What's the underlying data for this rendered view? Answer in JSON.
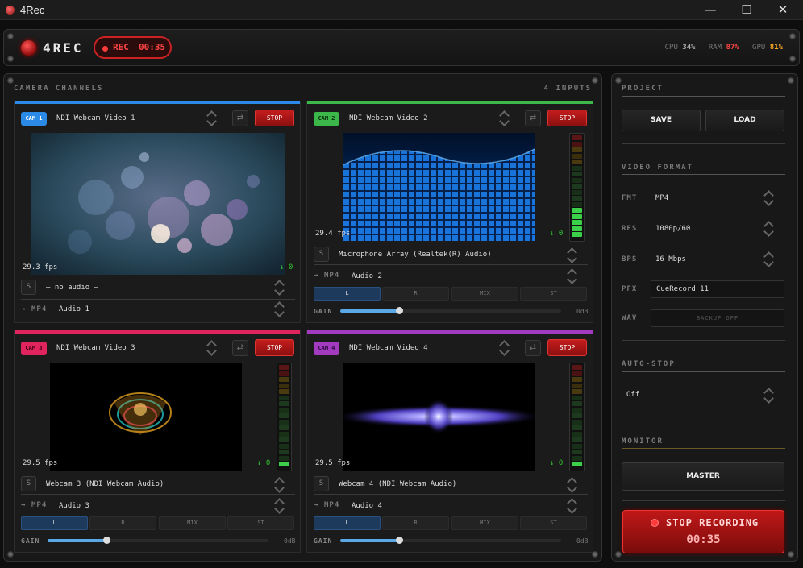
{
  "window": {
    "title": "4Rec",
    "minimize": "—",
    "maximize": "☐",
    "close": "✕"
  },
  "header": {
    "logo": "4REC",
    "rec_label": "REC",
    "rec_time": "00:35",
    "cpu_label": "CPU",
    "cpu_value": "34%",
    "ram_label": "RAM",
    "ram_value": "87%",
    "gpu_label": "GPU",
    "gpu_value": "81%",
    "cpu_color": "#aaaaaa",
    "ram_color": "#ff4444",
    "gpu_color": "#ffaa22"
  },
  "channels": {
    "title": "CAMERA CHANNELS",
    "inputs": "4 INPUTS",
    "cams": [
      {
        "badge": "CAM 1",
        "color": "#2a8ae6",
        "name": "NDI Webcam Video 1",
        "stop": "STOP",
        "fps": "29.3 fps",
        "level": "↓ 0",
        "solo": "S",
        "audio": "— no audio —",
        "fmt_arrow": "→",
        "fmt": "MP4",
        "audio_track": "Audio 1"
      },
      {
        "badge": "CAM 2",
        "color": "#3cb84a",
        "name": "NDI Webcam Video 2",
        "stop": "STOP",
        "fps": "29.4 fps",
        "level": "↓ 0",
        "solo": "S",
        "audio": "Microphone Array (Realtek(R) Audio)",
        "fmt_arrow": "→",
        "fmt": "MP4",
        "audio_track": "Audio 2",
        "meter_level": 0.3,
        "gain_db": "0dB"
      },
      {
        "badge": "CAM 3",
        "color": "#e0245e",
        "name": "NDI Webcam Video 3",
        "stop": "STOP",
        "fps": "29.5 fps",
        "level": "↓ 0",
        "solo": "S",
        "audio": "Webcam 3 (NDI Webcam Audio)",
        "fmt_arrow": "→",
        "fmt": "MP4",
        "audio_track": "Audio 3",
        "meter_level": 0.05,
        "gain_db": "0dB"
      },
      {
        "badge": "CAM 4",
        "color": "#a23bc0",
        "name": "NDI Webcam Video 4",
        "stop": "STOP",
        "fps": "29.5 fps",
        "level": "↓ 0",
        "solo": "S",
        "audio": "Webcam 4 (NDI Webcam Audio)",
        "fmt_arrow": "→",
        "fmt": "MP4",
        "audio_track": "Audio 4",
        "meter_level": 0.05,
        "gain_db": "0dB"
      }
    ],
    "channel_modes": [
      "L",
      "R",
      "MIX",
      "ST"
    ],
    "gain_label": "GAIN"
  },
  "project": {
    "title": "PROJECT",
    "save": "SAVE",
    "load": "LOAD",
    "video_format_title": "VIDEO FORMAT",
    "fmt_label": "FMT",
    "fmt_value": "MP4",
    "res_label": "RES",
    "res_value": "1080p/60",
    "bps_label": "BPS",
    "bps_value": "16 Mbps",
    "pfx_label": "PFX",
    "pfx_value": "CueRecord 11",
    "wav_label": "WAV",
    "wav_value": "BACKUP OFF",
    "autostop_title": "AUTO-STOP",
    "autostop_value": "Off",
    "monitor_title": "MONITOR",
    "monitor_button": "MASTER",
    "stop_recording": "STOP RECORDING",
    "stop_time": "00:35"
  }
}
